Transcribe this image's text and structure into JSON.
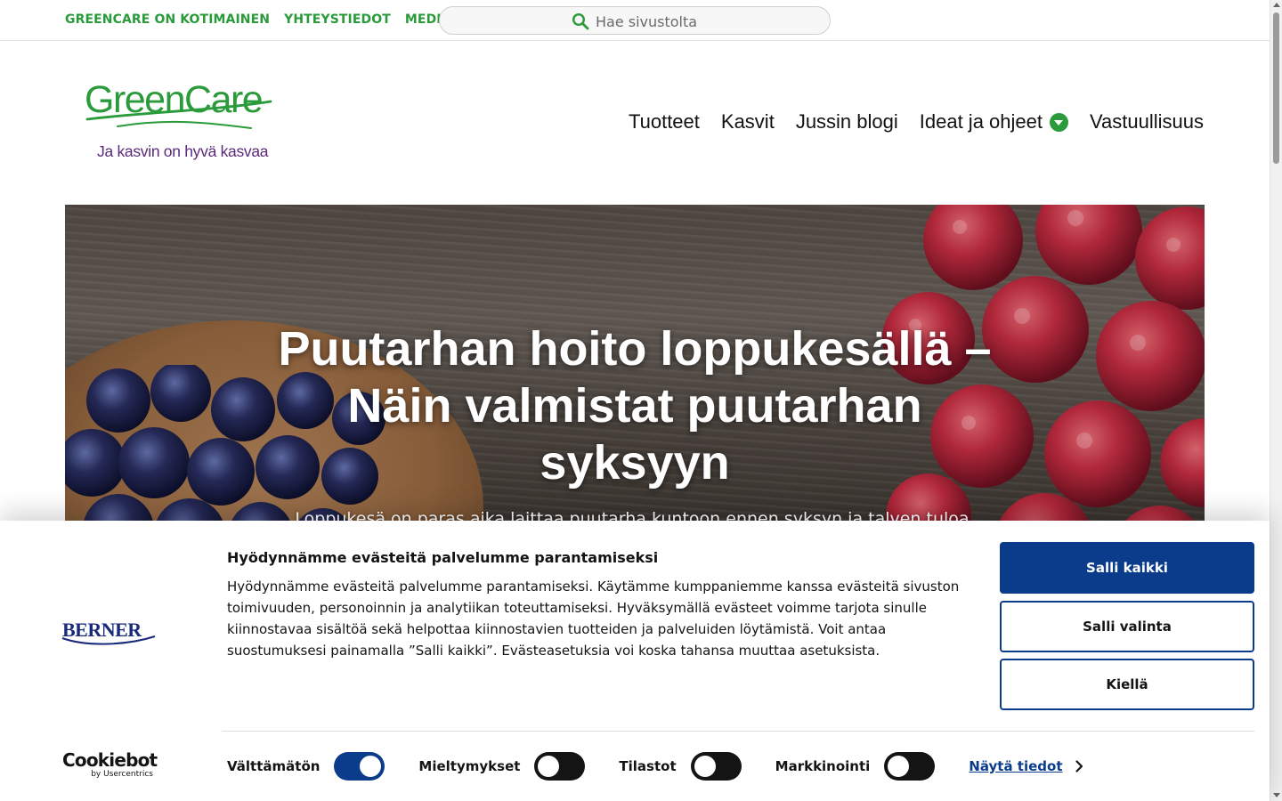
{
  "topbar": {
    "links": [
      "GREENCARE ON KOTIMAINEN",
      "YHTEYSTIEDOT",
      "MEDIALLE"
    ],
    "search_placeholder": "Hae sivustolta"
  },
  "logo": {
    "name": "GreenCare",
    "tagline": "Ja kasvin on hyvä kasvaa"
  },
  "nav": {
    "items": [
      "Tuotteet",
      "Kasvit",
      "Jussin blogi",
      "Ideat ja ohjeet",
      "Vastuullisuus"
    ]
  },
  "hero": {
    "title": "Puutarhan hoito loppukesällä – Näin valmistat puutarhan syksyyn",
    "subtitle": "Loppukesä on paras aika laittaa puutarha kuntoon ennen syksyn ja talven tuloa."
  },
  "cookie": {
    "brand": "BERNER",
    "title": "Hyödynnämme evästeitä palvelumme parantamiseksi",
    "text": "Hyödynnämme evästeitä palvelumme parantamiseksi. Käytämme kumppaniemme kanssa evästeitä sivuston toimivuuden, personoinnin ja analytiikan toteuttamiseksi. Hyväksymällä evästeet voimme tarjota sinulle kiinnostavaa sisältöä sekä helpottaa kiinnostavien tuotteiden ja palveluiden löytämistä. Voit antaa suostumuksesi painamalla ”Salli kaikki”. Evästeasetuksia voi koska tahansa muuttaa asetuksista.",
    "buttons": {
      "allow_all": "Salli kaikki",
      "allow_selection": "Salli valinta",
      "deny": "Kiellä"
    },
    "toggles": [
      {
        "label": "Välttämätön",
        "on": true
      },
      {
        "label": "Mieltymykset",
        "on": false
      },
      {
        "label": "Tilastot",
        "on": false
      },
      {
        "label": "Markkinointi",
        "on": false
      }
    ],
    "show_details": "Näytä tiedot",
    "cookiebot_name": "Cookiebot",
    "cookiebot_by": "by Usercentrics"
  },
  "colors": {
    "brand_green": "#2a9a3a",
    "brand_purple": "#5b2a7a",
    "cookie_blue": "#0b3c8c"
  }
}
